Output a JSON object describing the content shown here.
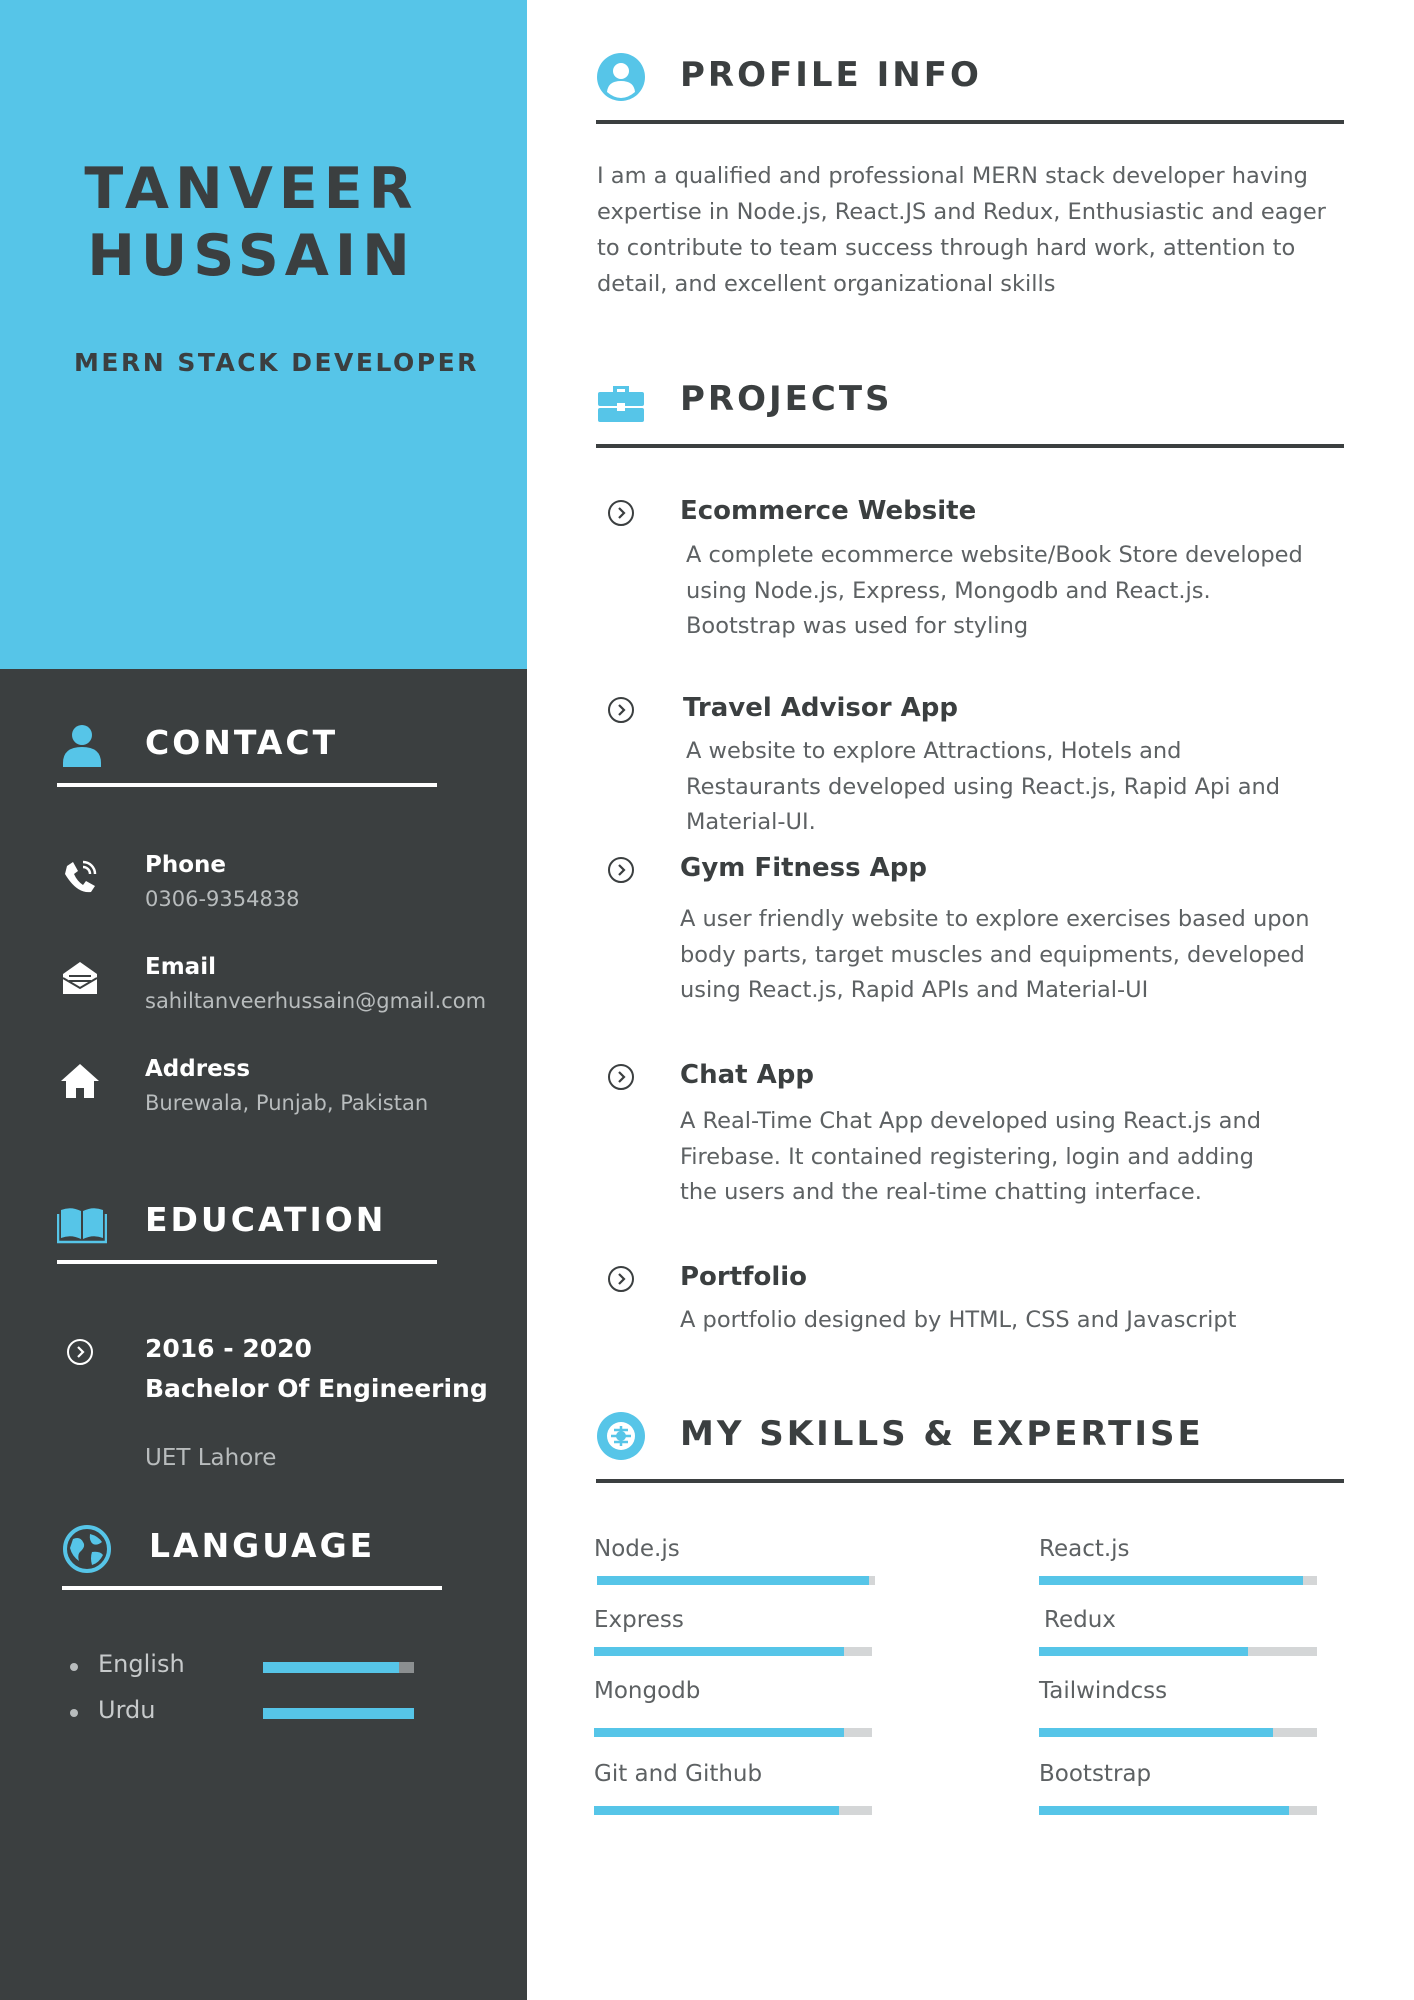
{
  "header": {
    "name_line1": "TANVEER",
    "name_line2": "HUSSAIN",
    "role": "MERN STACK DEVELOPER"
  },
  "contact": {
    "heading": "CONTACT",
    "items": [
      {
        "label": "Phone",
        "value": "0306-9354838",
        "icon": "phone-icon"
      },
      {
        "label": "Email",
        "value": "sahiltanveerhussain@gmail.com",
        "icon": "envelope-icon"
      },
      {
        "label": "Address",
        "value": "Burewala, Punjab, Pakistan",
        "icon": "home-icon"
      }
    ]
  },
  "education": {
    "heading": "EDUCATION",
    "years": "2016 - 2020",
    "degree": "Bachelor Of Engineering",
    "school": "UET Lahore"
  },
  "language": {
    "heading": "LANGUAGE",
    "items": [
      {
        "name": "English",
        "level": 0.9
      },
      {
        "name": "Urdu",
        "level": 1.0
      }
    ]
  },
  "profile": {
    "heading": "PROFILE INFO",
    "text": "I am a qualified and professional MERN stack developer having expertise in Node.js, React.JS and Redux, Enthusiastic and eager to contribute to team success through hard work, attention to detail, and excellent organizational skills"
  },
  "projects": {
    "heading": "PROJECTS",
    "items": [
      {
        "title": "Ecommerce Website",
        "description": "A complete  ecommerce website/Book Store developed using Node.js, Express, Mongodb and React.js.  Bootstrap was used for styling"
      },
      {
        "title": "Travel Advisor App",
        "description": "A website to explore Attractions, Hotels and Restaurants developed using React.js, Rapid Api and Material-UI."
      },
      {
        "title": "Gym Fitness App",
        "description": "A user friendly website to explore exercises based upon body parts, target muscles and equipments, developed using React.js, Rapid APIs and Material-UI"
      },
      {
        "title": "Chat App",
        "description": "A Real-Time Chat App developed using React.js and Firebase. It contained registering, login and adding the users and the real-time chatting interface."
      },
      {
        "title": "Portfolio",
        "description": "A portfolio designed by HTML, CSS and Javascript"
      }
    ]
  },
  "skills": {
    "heading": "MY SKILLS & EXPERTISE",
    "items": [
      {
        "name": "Node.js",
        "level": 0.98
      },
      {
        "name": "React.js",
        "level": 0.95
      },
      {
        "name": "Express",
        "level": 0.9
      },
      {
        "name": "Redux",
        "level": 0.75
      },
      {
        "name": "Mongodb",
        "level": 0.9
      },
      {
        "name": "Tailwindcss",
        "level": 0.84
      },
      {
        "name": "Git and Github",
        "level": 0.88
      },
      {
        "name": "Bootstrap",
        "level": 0.9
      }
    ]
  },
  "colors": {
    "accent": "#56c5e8",
    "dark": "#3b3f40"
  }
}
